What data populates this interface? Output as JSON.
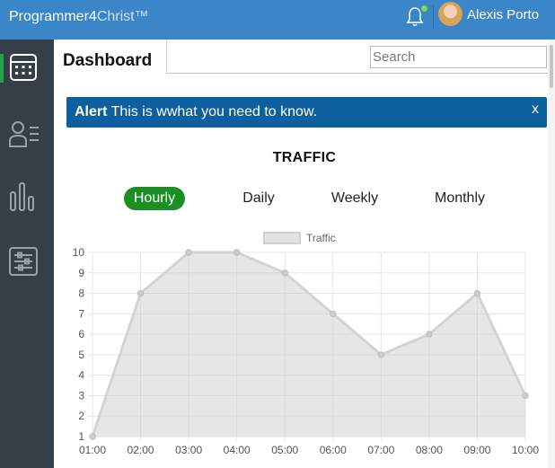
{
  "app": {
    "logo_main": "Programmer4",
    "logo_light": "Christ™"
  },
  "user": {
    "name": "Alexis Porto"
  },
  "header": {
    "title": "Dashboard",
    "search_placeholder": "Search"
  },
  "sidebar": {
    "items": [
      {
        "icon": "calendar-icon",
        "active": true
      },
      {
        "icon": "members-icon",
        "active": false
      },
      {
        "icon": "bar-chart-icon",
        "active": false
      },
      {
        "icon": "settings-sliders-icon",
        "active": false
      }
    ]
  },
  "alert": {
    "label": "Alert",
    "message": "This is wwhat you need to know.",
    "close": "x"
  },
  "traffic": {
    "title": "TRAFFIC",
    "tabs": [
      "Hourly",
      "Daily",
      "Weekly",
      "Monthly"
    ],
    "active_tab": "Hourly"
  },
  "colors": {
    "topbar": "#3a86c9",
    "sidebar": "#353f48",
    "alert": "#0e5f9e",
    "active_tab": "#1c8f24",
    "notification_dot": "#7ed956"
  },
  "chart_data": {
    "type": "area",
    "categories": [
      "01:00",
      "02:00",
      "03:00",
      "04:00",
      "05:00",
      "06:00",
      "07:00",
      "08:00",
      "09:00",
      "10:00"
    ],
    "series": [
      {
        "name": "Traffic",
        "values": [
          1,
          8,
          10,
          10,
          9,
          7,
          5,
          6,
          8,
          3
        ]
      }
    ],
    "ylim": [
      1,
      10
    ],
    "yticks": [
      1,
      2,
      3,
      4,
      5,
      6,
      7,
      8,
      9,
      10
    ],
    "grid": true,
    "legend": "top"
  }
}
